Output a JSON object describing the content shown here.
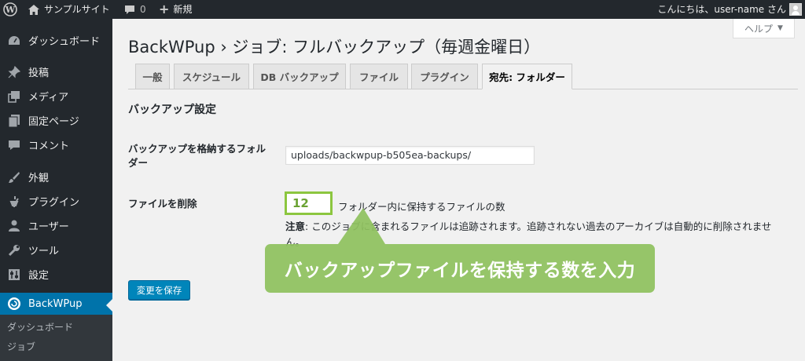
{
  "adminbar": {
    "site_name": "サンプルサイト",
    "comment_count": "0",
    "new_label": "新規",
    "greeting": "こんにちは、user-name さん"
  },
  "help": {
    "label": "ヘルプ",
    "caret": "▼"
  },
  "sidebar": {
    "items": [
      {
        "label": "ダッシュボード",
        "icon": "dashboard-icon"
      },
      {
        "label": "投稿",
        "icon": "pin-icon"
      },
      {
        "label": "メディア",
        "icon": "media-icon"
      },
      {
        "label": "固定ページ",
        "icon": "page-icon"
      },
      {
        "label": "コメント",
        "icon": "comment-icon"
      },
      {
        "label": "外観",
        "icon": "brush-icon"
      },
      {
        "label": "プラグイン",
        "icon": "plugin-icon"
      },
      {
        "label": "ユーザー",
        "icon": "user-icon"
      },
      {
        "label": "ツール",
        "icon": "wrench-icon"
      },
      {
        "label": "設定",
        "icon": "settings-icon"
      },
      {
        "label": "BackWPup",
        "icon": "backwpup-icon"
      }
    ],
    "submenu": [
      "ダッシュボード",
      "ジョブ"
    ]
  },
  "page": {
    "title": "BackWPup › ジョブ: フルバックアップ（毎週金曜日）"
  },
  "tabs": [
    {
      "label": "一般"
    },
    {
      "label": "スケジュール"
    },
    {
      "label": "DB バックアップ"
    },
    {
      "label": "ファイル"
    },
    {
      "label": "プラグイン"
    },
    {
      "label": "宛先: フォルダー"
    }
  ],
  "section": {
    "title": "バックアップ設定",
    "folder_label_line1": "バックアップを格納するフォル",
    "folder_label_line2": "ダー",
    "folder_value": "uploads/backwpup-b505ea-backups/",
    "delete_label": "ファイルを削除",
    "max_files_value": "12",
    "max_files_desc": "フォルダー内に保持するファイルの数",
    "note_prefix": "注意",
    "note_text": ": このジョブに含まれるファイルは追跡されます。追跡されない過去のアーカイブは自動的に削除されません。"
  },
  "save_label": "変更を保存",
  "callout": {
    "text": "バックアップファイルを保持する数を入力",
    "color": "#8fc25f"
  },
  "colors": {
    "adminbar": "#23282d",
    "sidebar": "#23282d",
    "current_menu": "#0073aa",
    "primary_button": "#0085ba",
    "highlight_border": "#8cc63f"
  }
}
